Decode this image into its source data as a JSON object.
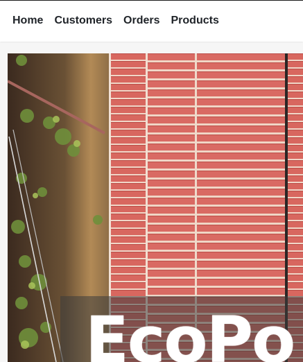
{
  "nav": {
    "items": [
      {
        "label": "Home"
      },
      {
        "label": "Customers"
      },
      {
        "label": "Orders"
      },
      {
        "label": "Products"
      }
    ]
  },
  "hero": {
    "title": "EcoPo",
    "image_description_icon": "aerial-roof-photo",
    "colors": {
      "roof": "#d9665e",
      "vegetation": "#3d5a2a",
      "overlay": "#3c3c3c"
    }
  }
}
